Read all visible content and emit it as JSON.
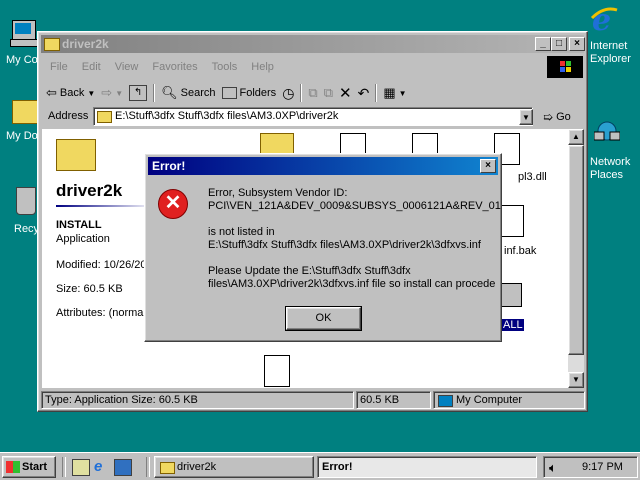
{
  "desktop": {
    "icons": [
      {
        "id": "mycomputer",
        "label": "My Co"
      },
      {
        "id": "mydocs",
        "label": "My Do"
      },
      {
        "id": "recycle",
        "label": "Recy"
      },
      {
        "id": "ie",
        "label": "Internet Explorer"
      },
      {
        "id": "network",
        "label": "Network Places"
      }
    ]
  },
  "explorer": {
    "title": "driver2k",
    "menu": [
      "File",
      "Edit",
      "View",
      "Favorites",
      "Tools",
      "Help"
    ],
    "toolbar": {
      "back": "Back",
      "search": "Search",
      "folders": "Folders"
    },
    "address": {
      "label": "Address",
      "value": "E:\\Stuff\\3dfx Stuff\\3dfx files\\AM3.0XP\\driver2k",
      "go": "Go"
    },
    "left_pane": {
      "folder_title": "driver2k",
      "file_name": "INSTALL",
      "file_type": "Application",
      "modified": "Modified: 10/26/20",
      "size": "Size: 60.5 KB",
      "attributes": "Attributes: (norma"
    },
    "files_visible": [
      "pl3.dll",
      "inf.bak",
      "ALL"
    ],
    "status": {
      "left": "Type: Application Size: 60.5 KB",
      "mid": "60.5 KB",
      "right": "My Computer"
    }
  },
  "dialog": {
    "title": "Error!",
    "line1": "Error, Subsystem Vendor ID:",
    "line2": "PCI\\VEN_121A&DEV_0009&SUBSYS_0006121A&REV_01",
    "line3": "is not listed in",
    "line4": "E:\\Stuff\\3dfx Stuff\\3dfx files\\AM3.0XP\\driver2k\\3dfxvs.inf",
    "line5": "Please Update the E:\\Stuff\\3dfx Stuff\\3dfx",
    "line6": "files\\AM3.0XP\\driver2k\\3dfxvs.inf file so install can procede",
    "ok": "OK"
  },
  "taskbar": {
    "start": "Start",
    "tasks": [
      {
        "label": "driver2k"
      },
      {
        "label": "Error!"
      }
    ],
    "clock": "9:17 PM"
  }
}
